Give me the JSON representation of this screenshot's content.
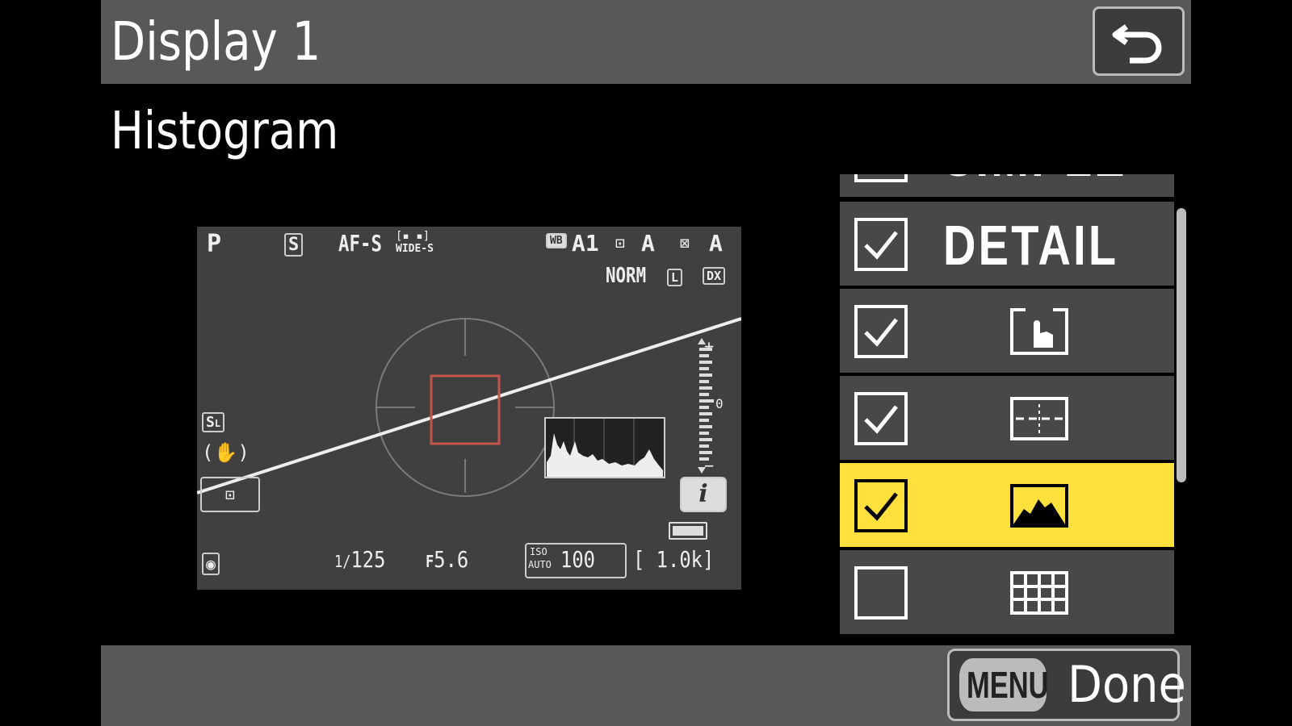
{
  "header": {
    "title": "Display 1",
    "back_icon": "return-arrow-icon"
  },
  "subtitle": "Histogram",
  "liveview": {
    "mode": "P",
    "release_mode": "S",
    "af_mode": "AF-S",
    "af_area": "WIDE-S",
    "wb": "A1",
    "picture_control": "A",
    "active_dlighting": "A",
    "quality": "NORM",
    "size": "L",
    "crop": "DX",
    "shutter_prefix": "1/",
    "shutter": "125",
    "aperture_prefix": "F",
    "aperture": "5.6",
    "iso_label_top": "ISO",
    "iso_label_bottom": "AUTO",
    "iso": "100",
    "shots_remaining": "1.0k",
    "info_label": "i",
    "exposure_scale_plus": "+",
    "exposure_scale_minus": "−",
    "exposure_scale_zero": "0"
  },
  "list": {
    "items": [
      {
        "label": "SIMPLE",
        "checked": false,
        "selected": false,
        "icon": "text"
      },
      {
        "label": "DETAIL",
        "checked": true,
        "selected": false,
        "icon": "text"
      },
      {
        "label": "",
        "checked": true,
        "selected": false,
        "icon": "touch-shutter-icon"
      },
      {
        "label": "",
        "checked": true,
        "selected": false,
        "icon": "virtual-horizon-icon"
      },
      {
        "label": "",
        "checked": true,
        "selected": true,
        "icon": "histogram-icon"
      },
      {
        "label": "",
        "checked": false,
        "selected": false,
        "icon": "grid-icon"
      }
    ]
  },
  "footer": {
    "menu_label": "MENU",
    "done_label": "Done"
  },
  "colors": {
    "selected": "#ffe03c",
    "row": "#484848",
    "bar": "#585858"
  }
}
